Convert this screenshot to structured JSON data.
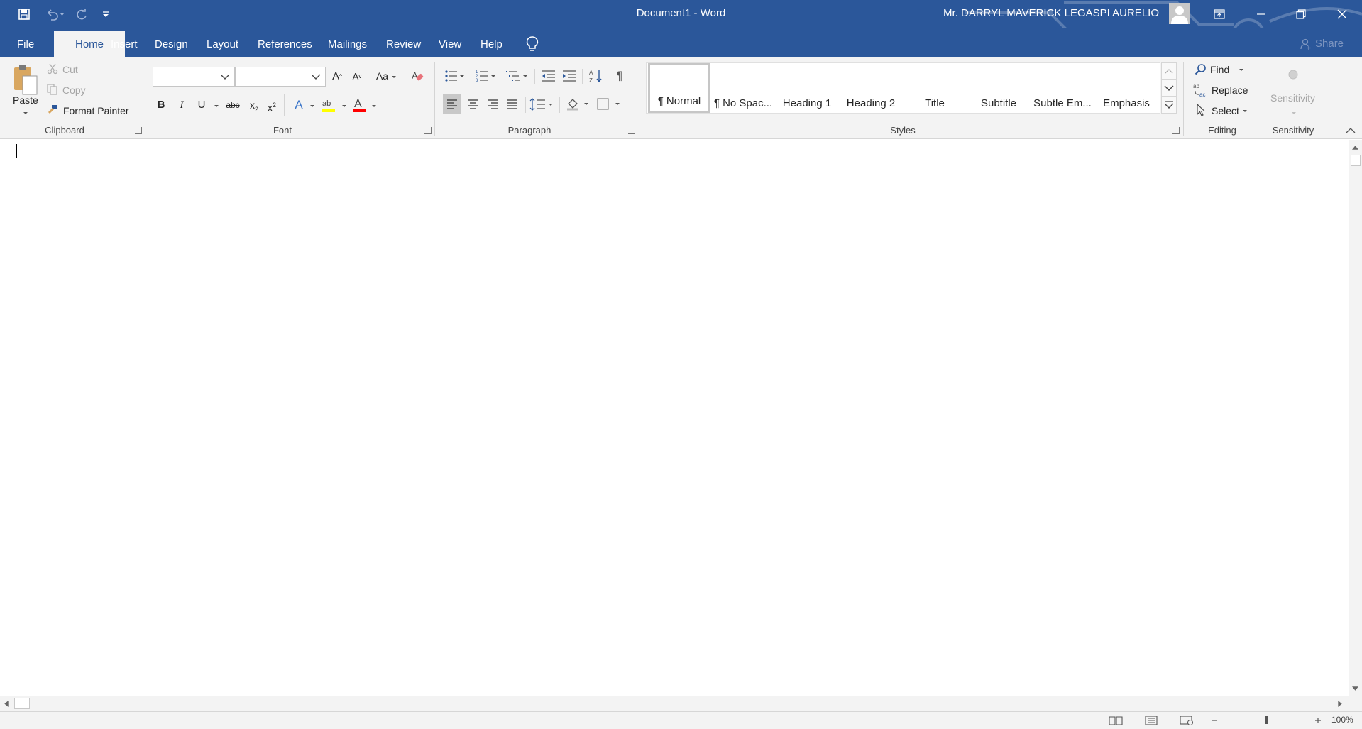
{
  "window": {
    "document_title": "Document1  -  Word",
    "user_name": "Mr. DARRYL MAVERICK LEGASPI AURELIO"
  },
  "quick_access": [
    "save-icon",
    "undo-icon",
    "redo-icon",
    "customize-qat-icon"
  ],
  "ribbon_tabs": [
    "File",
    "Home",
    "Insert",
    "Design",
    "Layout",
    "References",
    "Mailings",
    "Review",
    "View",
    "Help"
  ],
  "active_tab": "Home",
  "share_label": "Share",
  "clipboard": {
    "paste": "Paste",
    "cut": "Cut",
    "copy": "Copy",
    "format_painter": "Format Painter",
    "group": "Clipboard"
  },
  "font": {
    "font_name": "",
    "font_size": "",
    "group": "Font"
  },
  "paragraph": {
    "group": "Paragraph"
  },
  "styles": {
    "items": [
      "¶ Normal",
      "¶ No Spac...",
      "Heading 1",
      "Heading 2",
      "Title",
      "Subtitle",
      "Subtle Em...",
      "Emphasis"
    ],
    "selected": "¶ Normal",
    "group": "Styles"
  },
  "editing": {
    "find": "Find",
    "replace": "Replace",
    "select": "Select",
    "group": "Editing"
  },
  "sensitivity": {
    "button": "Sensitivity",
    "group": "Sensitivity"
  },
  "status": {
    "zoom": "100%",
    "zoom_fraction": 0.5
  },
  "colors": {
    "word_blue": "#2b579a",
    "highlight_yellow": "#ffff00",
    "font_color_red": "#ff0000"
  }
}
